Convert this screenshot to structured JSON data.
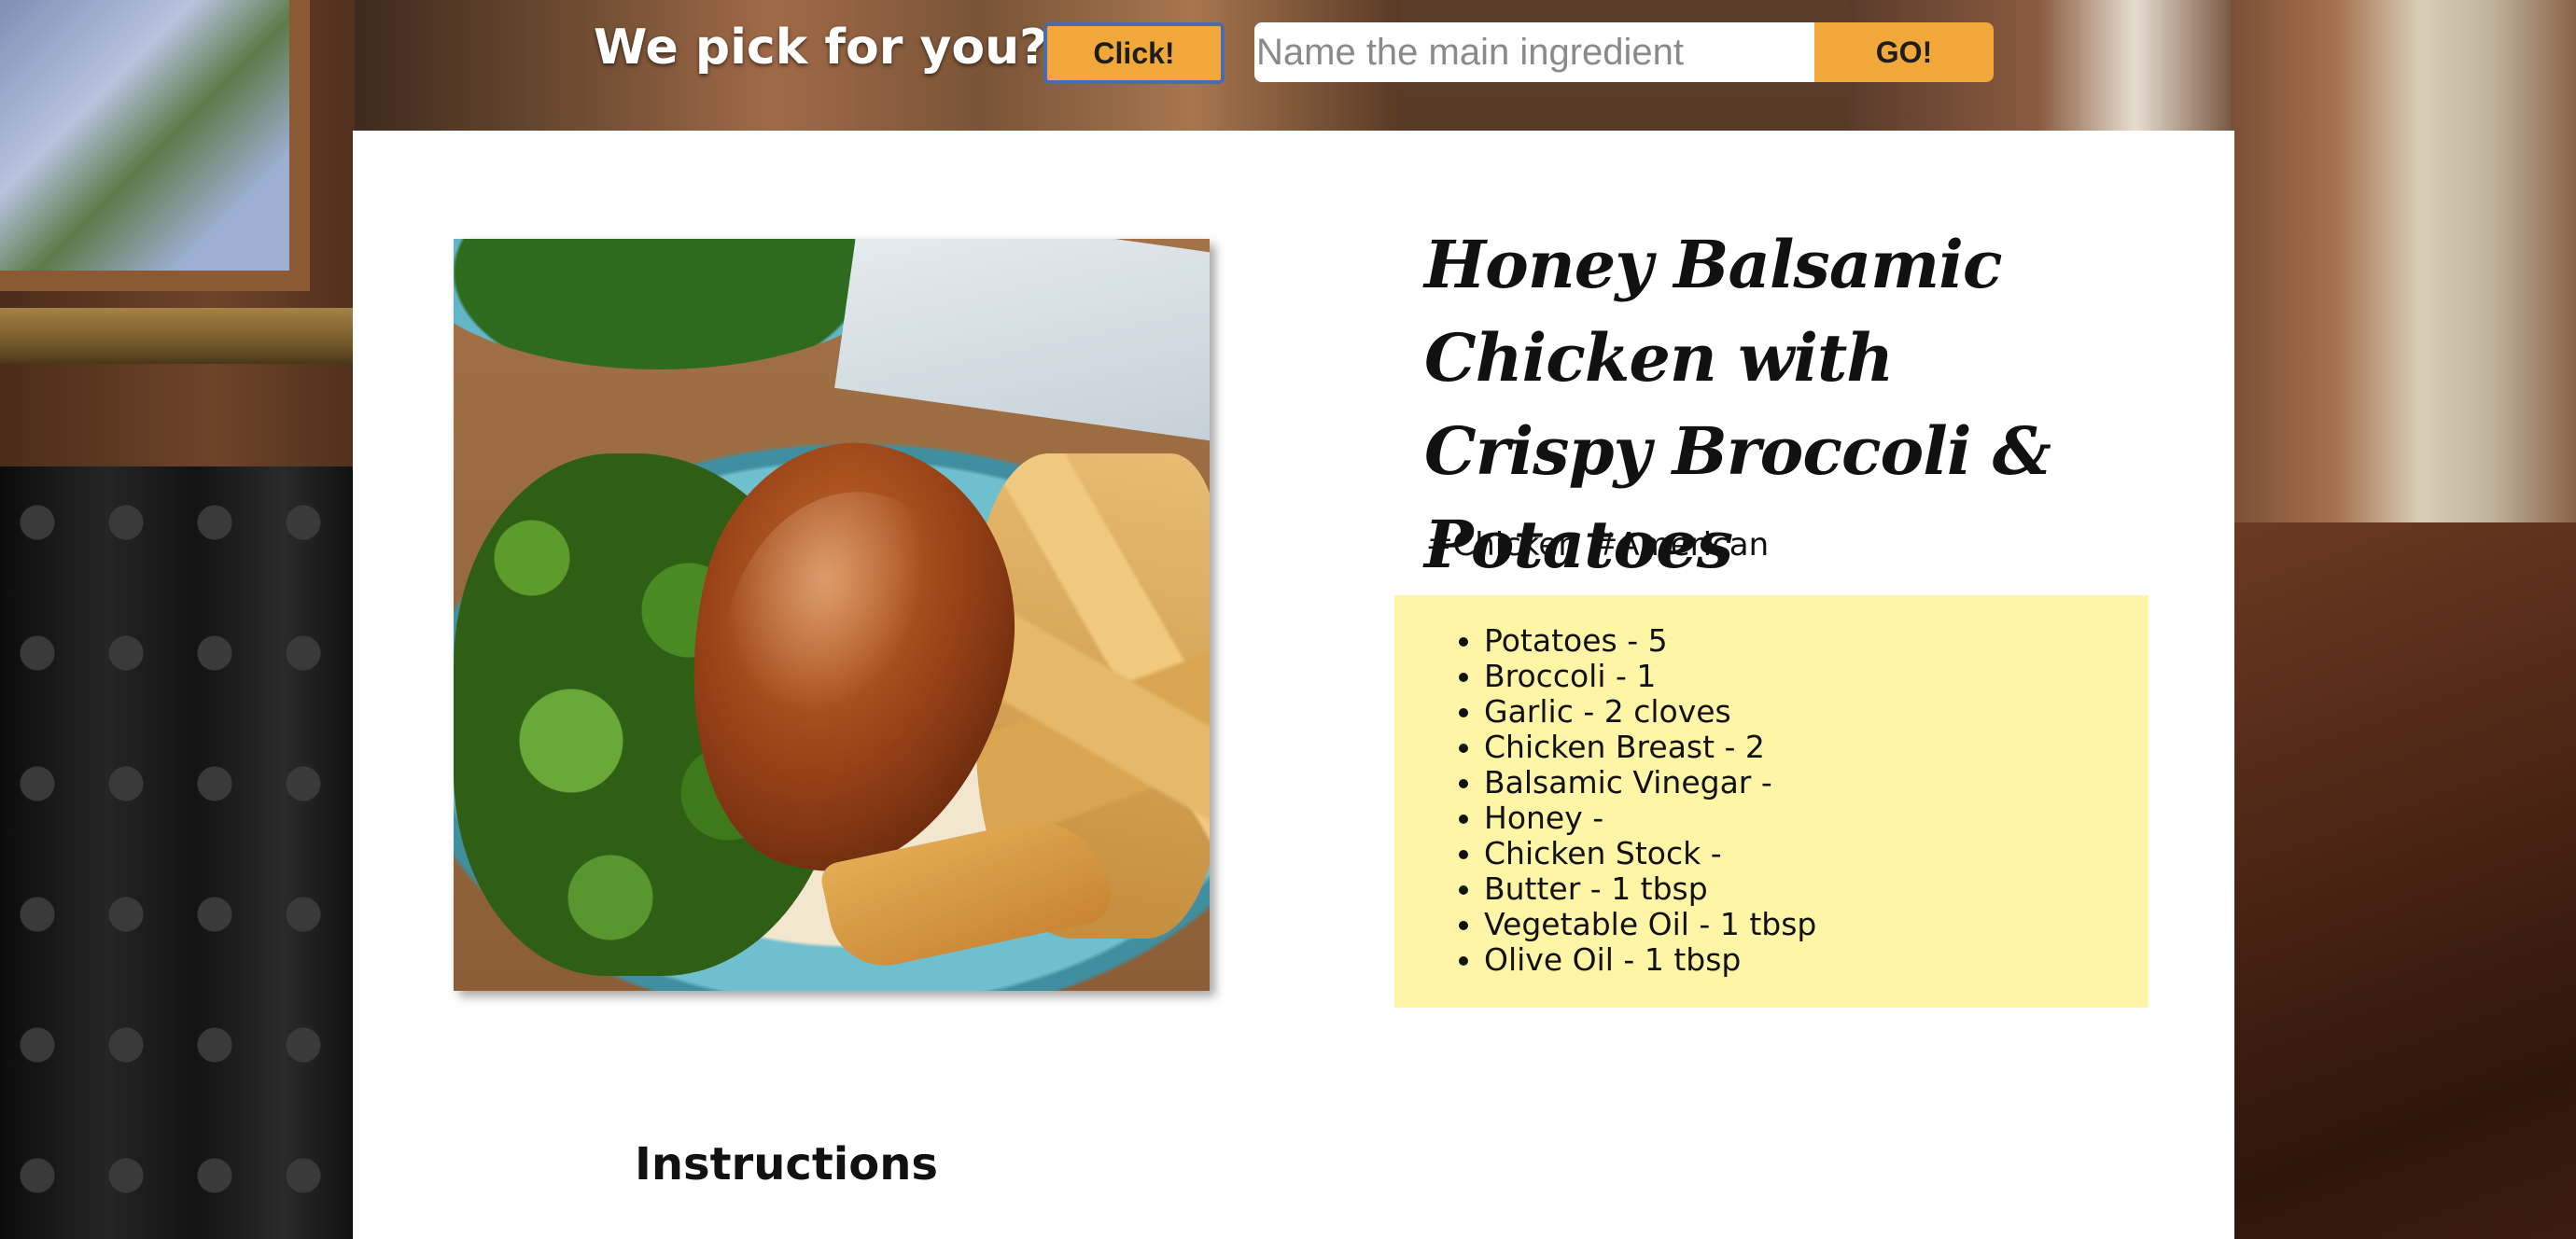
{
  "header": {
    "title": "We pick for you?",
    "pick_button_label": "Click!",
    "search_placeholder": "Name the main ingredient",
    "go_button_label": "GO!"
  },
  "recipe": {
    "title": "Honey Balsamic Chicken with Crispy Broccoli & Potatoes",
    "tags": [
      "#Chicken",
      "#American"
    ],
    "ingredients": [
      "Potatoes - 5",
      "Broccoli - 1",
      "Garlic - 2 cloves",
      "Chicken Breast - 2",
      "Balsamic Vinegar -",
      "Honey -",
      "Chicken Stock -",
      "Butter - 1 tbsp",
      "Vegetable Oil - 1 tbsp",
      "Olive Oil - 1 tbsp"
    ],
    "instructions_heading": "Instructions"
  },
  "colors": {
    "accent_button": "#f2a73a",
    "ingredients_background": "#fff5a6",
    "card_background": "#ffffff"
  }
}
